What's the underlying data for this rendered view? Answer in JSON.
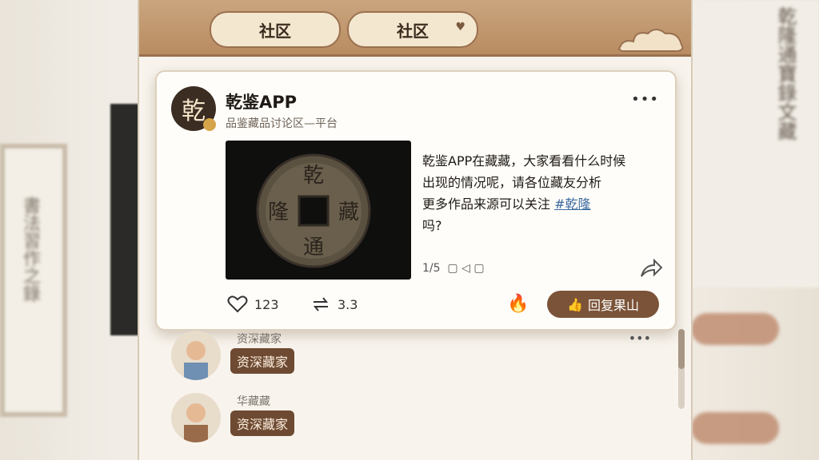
{
  "background": {
    "left_scroll_text": "書法習作之錄",
    "right_scroll_text": "乾隆通寶錄文藏"
  },
  "header": {
    "tabs": [
      {
        "label": "社区",
        "icon": ""
      },
      {
        "label": "社区",
        "icon": "heart-icon"
      }
    ]
  },
  "post": {
    "avatar_char": "乾",
    "title": "乾鉴APP",
    "subtitle": "品鉴藏品讨论区—平台",
    "image_chars": {
      "top": "乾",
      "left": "隆",
      "right": "藏",
      "bottom": "通"
    },
    "body_lines": [
      "乾鉴APP在藏藏，大家看看什么时候",
      "出现的情况呢，请各位藏友分析",
      "更多作品来源可以关注"
    ],
    "tag": "#乾隆",
    "question": "吗?",
    "counter": "1/5",
    "likes": "123",
    "reposts": "3.3",
    "reply_label": "回复果山"
  },
  "comments": [
    {
      "name": "资深藏家",
      "badge": "资深藏家"
    },
    {
      "name": "华藏藏",
      "badge": "资深藏家"
    }
  ],
  "colors": {
    "accent": "#7b5339",
    "bar": "#b98c61",
    "tag": "#3b6aa0"
  }
}
